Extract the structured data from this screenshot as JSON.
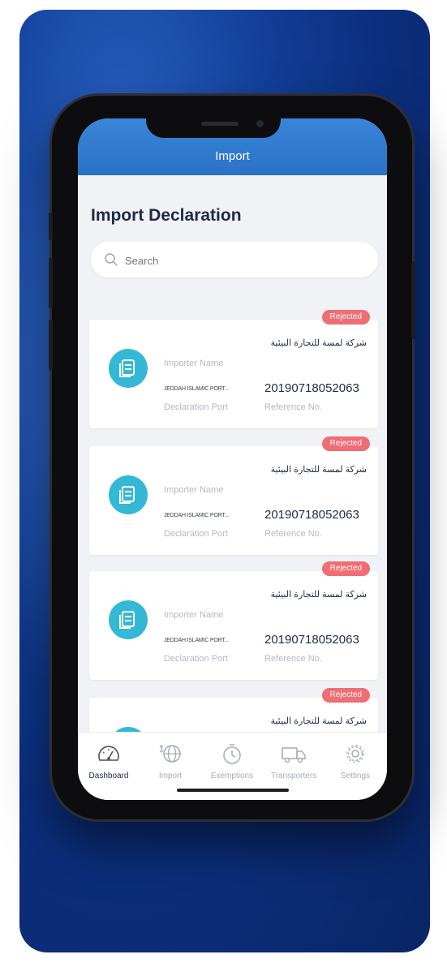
{
  "header": {
    "title": "Import"
  },
  "page": {
    "title": "Import Declaration"
  },
  "search": {
    "placeholder": "Search"
  },
  "cards": [
    {
      "status": "Rejected",
      "importer_name_value": "شركة لمسة للتجارة البيئية",
      "importer_name_label": "Importer Name",
      "declaration_port_value": "JEDDAH ISLAMIC PORT...",
      "declaration_port_label": "Declaration Port",
      "reference_no_value": "20190718052063",
      "reference_no_label": "Reference No."
    },
    {
      "status": "Rejected",
      "importer_name_value": "شركة لمسة للتجارة البيئية",
      "importer_name_label": "Importer Name",
      "declaration_port_value": "JEDDAH ISLAMIC PORT...",
      "declaration_port_label": "Declaration Port",
      "reference_no_value": "20190718052063",
      "reference_no_label": "Reference No."
    },
    {
      "status": "Rejected",
      "importer_name_value": "شركة لمسة للتجارة البيئية",
      "importer_name_label": "Importer Name",
      "declaration_port_value": "JEDDAH ISLAMIC PORT...",
      "declaration_port_label": "Declaration Port",
      "reference_no_value": "20190718052063",
      "reference_no_label": "Reference No."
    },
    {
      "status": "Rejected",
      "importer_name_value": "شركة لمسة للتجارة البيئية"
    }
  ],
  "tabbar": {
    "items": [
      {
        "label": "Dashboard",
        "icon": "speedometer-icon",
        "active": true
      },
      {
        "label": "Import",
        "icon": "globe-icon",
        "active": false
      },
      {
        "label": "Exemptions",
        "icon": "stopwatch-icon",
        "active": false
      },
      {
        "label": "Transporters",
        "icon": "truck-icon",
        "active": false
      },
      {
        "label": "Settings",
        "icon": "gear-icon",
        "active": false
      }
    ]
  },
  "colors": {
    "header": "#2a72c8",
    "badge": "#ef6d73",
    "doc_icon": "#35b7d6",
    "backdrop": "#0b2f7e"
  }
}
